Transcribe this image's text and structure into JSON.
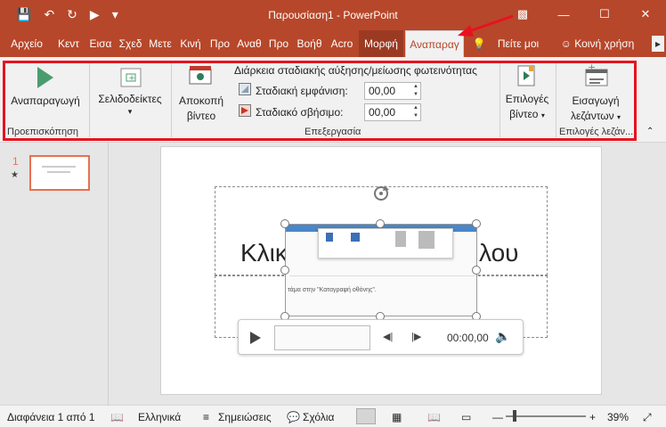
{
  "window": {
    "title": "Παρουσίαση1  -  PowerPoint"
  },
  "qat": {
    "save_icon": "save-icon",
    "undo_icon": "undo-icon",
    "redo_icon": "repeat-icon",
    "present_icon": "present-icon",
    "customize_icon": "customize-icon"
  },
  "winctl": {
    "ribbon_opt": "ribbon-display-icon",
    "minimize": "minimize-icon",
    "maximize": "maximize-icon",
    "close": "close-icon"
  },
  "tabs": [
    {
      "label": "Αρχείο"
    },
    {
      "label": "Κεντ"
    },
    {
      "label": "Εισα"
    },
    {
      "label": "Σχεδ"
    },
    {
      "label": "Μετε"
    },
    {
      "label": "Κινή"
    },
    {
      "label": "Προ"
    },
    {
      "label": "Αναθ"
    },
    {
      "label": "Προ"
    },
    {
      "label": "Βοήθ"
    },
    {
      "label": "Acro"
    },
    {
      "label": "Μορφή"
    },
    {
      "label": "Αναπαραγ"
    },
    {
      "label": "Πείτε μοι"
    },
    {
      "label": "Κοινή χρήση"
    }
  ],
  "ribbon": {
    "play_label": "Αναπαραγωγή",
    "preview_group": "Προεπισκόπηση",
    "bookmarks_label": "Σελιδοδείκτες",
    "trim_label_1": "Αποκοπή",
    "trim_label_2": "βίντεο",
    "fade_title": "Διάρκεια σταδιακής αύξησης/μείωσης φωτεινότητας",
    "fade_in_label": "Σταδιακή εμφάνιση:",
    "fade_in_value": "00,00",
    "fade_out_label": "Σταδιακό σβήσιμο:",
    "fade_out_value": "00,00",
    "editing_group": "Επεξεργασία",
    "video_options_1": "Επιλογές",
    "video_options_2": "βίντεο",
    "insert_captions_1": "Εισαγωγή",
    "insert_captions_2": "λεζάντων",
    "captions_group": "Επιλογές λεζάν..."
  },
  "thumbnails": [
    {
      "number": "1",
      "star": "★"
    }
  ],
  "slide": {
    "title_left": "Κλικ",
    "title_right": "λου",
    "video_text": "τάμα στην \"Καταγραφή οθόνης\".",
    "player_time": "00:00,00"
  },
  "status": {
    "slide": "Διαφάνεια 1 από 1",
    "language": "Ελληνικά",
    "notes": "Σημειώσεις",
    "comments": "Σχόλια",
    "zoom": "39%"
  },
  "colors": {
    "accent": "#b7472a",
    "highlight": "#e8121f"
  }
}
